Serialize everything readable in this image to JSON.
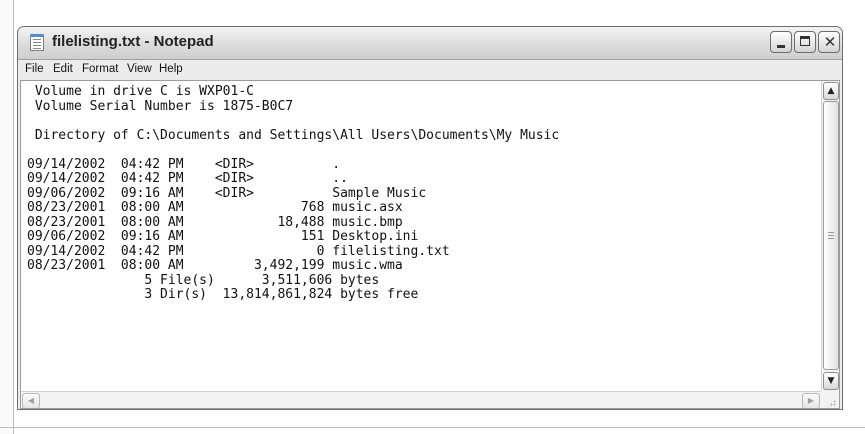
{
  "window": {
    "title": "filelisting.txt - Notepad",
    "app_icon": "notepad-icon",
    "controls": {
      "minimize_icon": "minimize-icon",
      "maximize_icon": "maximize-icon",
      "close_icon": "close-icon",
      "close_glyph": "✕"
    }
  },
  "menu": {
    "file": "File",
    "edit": "Edit",
    "format": "Format",
    "view": "View",
    "help": "Help"
  },
  "document": {
    "lines": [
      " Volume in drive C is WXP01-C",
      " Volume Serial Number is 1875-B0C7",
      "",
      " Directory of C:\\Documents and Settings\\All Users\\Documents\\My Music",
      "",
      "09/14/2002  04:42 PM    <DIR>          .",
      "09/14/2002  04:42 PM    <DIR>          ..",
      "09/06/2002  09:16 AM    <DIR>          Sample Music",
      "08/23/2001  08:00 AM               768 music.asx",
      "08/23/2001  08:00 AM            18,488 music.bmp",
      "09/06/2002  09:16 AM               151 Desktop.ini",
      "09/14/2002  04:42 PM                 0 filelisting.txt",
      "08/23/2001  08:00 AM         3,492,199 music.wma",
      "               5 File(s)      3,511,606 bytes",
      "               3 Dir(s)  13,814,861,824 bytes free"
    ]
  },
  "scrollbars": {
    "up_arrow": "▲",
    "down_arrow": "▼",
    "left_arrow": "◀",
    "right_arrow": "▶"
  },
  "colors": {
    "text": "#111111",
    "editor_background": "#ffffff",
    "chrome": "#ececec"
  }
}
